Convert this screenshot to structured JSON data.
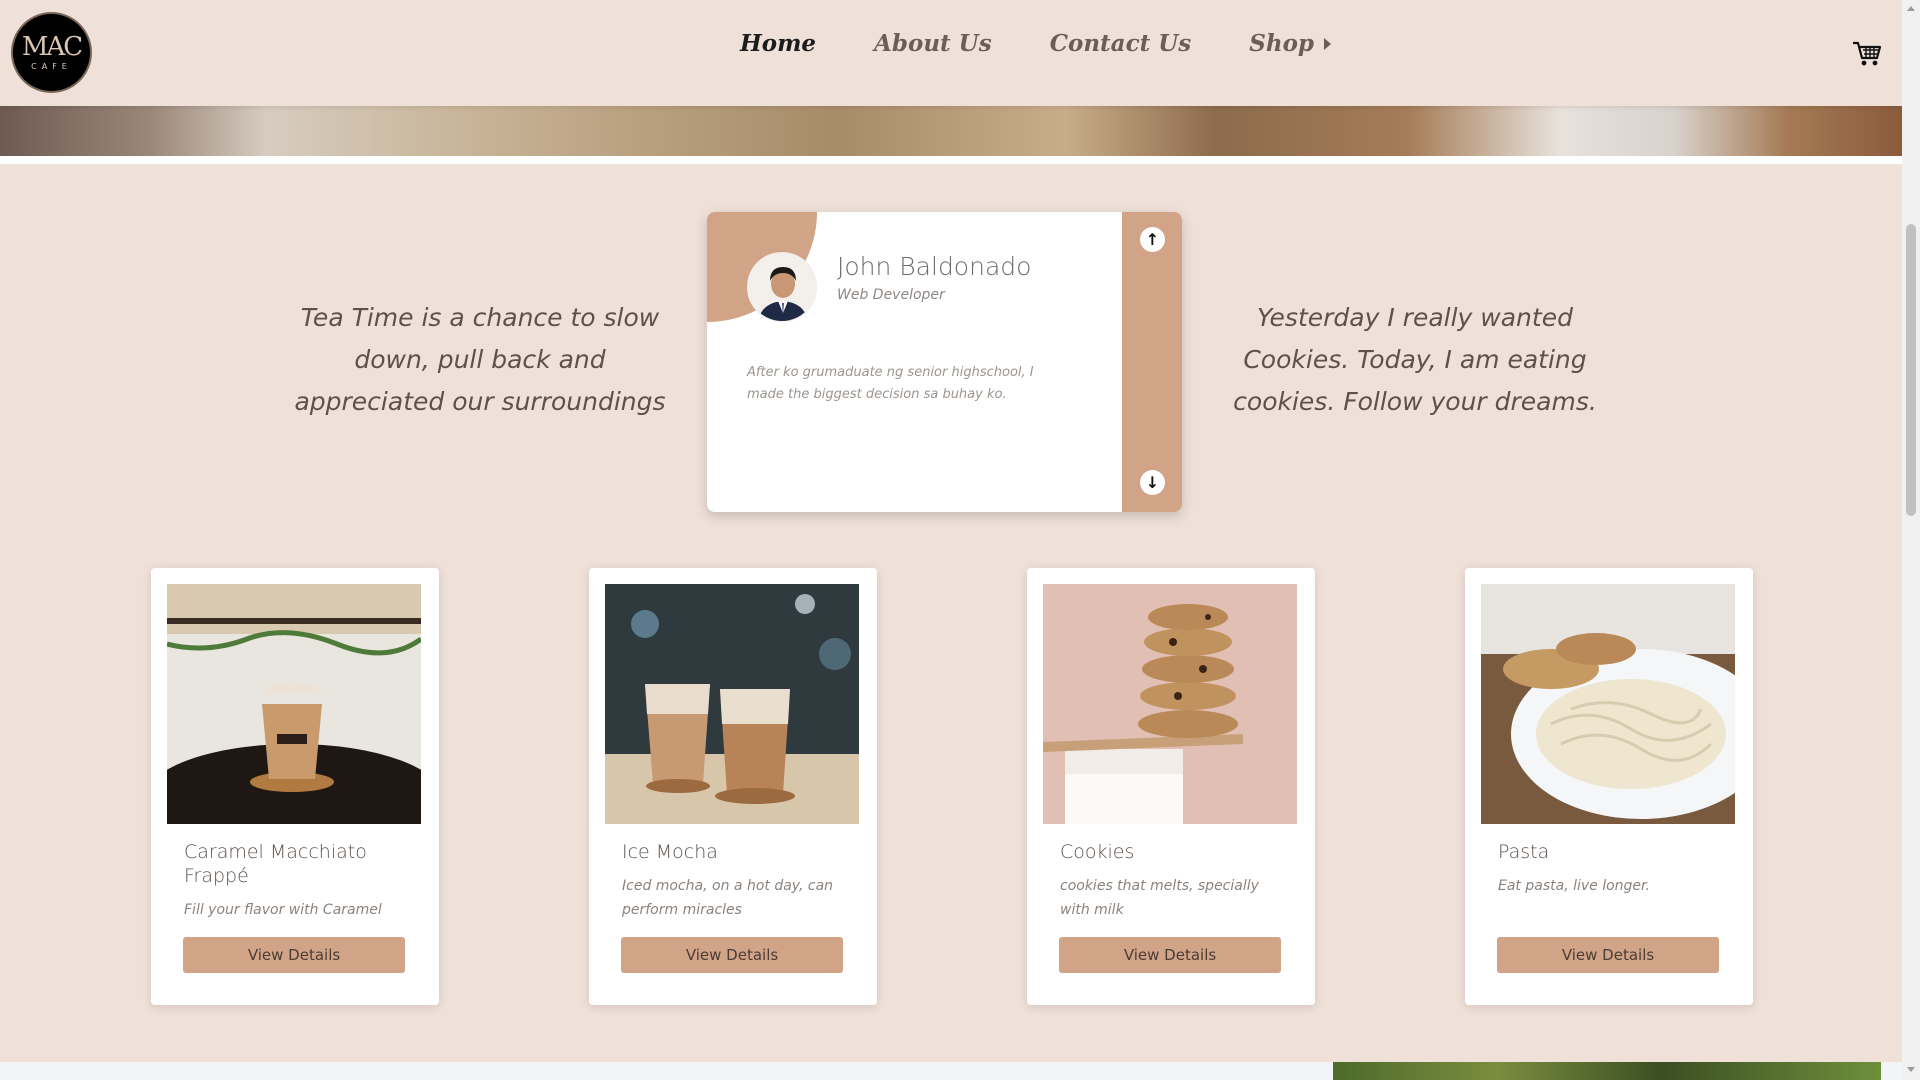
{
  "header": {
    "logo": {
      "main": "MAC",
      "sub": "CAFE"
    },
    "nav": [
      {
        "label": "Home",
        "active": true
      },
      {
        "label": "About Us",
        "active": false
      },
      {
        "label": "Contact Us",
        "active": false
      },
      {
        "label": "Shop",
        "active": false,
        "has_submenu": true
      }
    ],
    "cart_icon": "shopping-cart-icon"
  },
  "quotes": {
    "left": "Tea Time is a chance to slow down, pull back and appreciated our surroundings",
    "right": "Yesterday I really wanted Cookies. Today, I am eating cookies. Follow your dreams."
  },
  "testimonial": {
    "name": "John Baldonado",
    "role": "Web Developer",
    "text": "After ko grumaduate ng senior highschool, I made the biggest decision sa buhay ko.",
    "up_icon": "arrow-up-icon",
    "down_icon": "arrow-down-icon"
  },
  "products": [
    {
      "name": "Caramel Macchiato Frappé",
      "description": "Fill your flavor with Caramel",
      "button": "View Details"
    },
    {
      "name": "Ice Mocha",
      "description": "Iced mocha, on a hot day, can perform miracles",
      "button": "View Details"
    },
    {
      "name": "Cookies",
      "description": "cookies that melts, specially with milk",
      "button": "View Details"
    },
    {
      "name": "Pasta",
      "description": "Eat pasta, live longer.",
      "button": "View Details"
    }
  ],
  "colors": {
    "background": "#efe1d8",
    "accent": "#d1a488",
    "card": "#ffffff",
    "text": "#5e5148"
  }
}
